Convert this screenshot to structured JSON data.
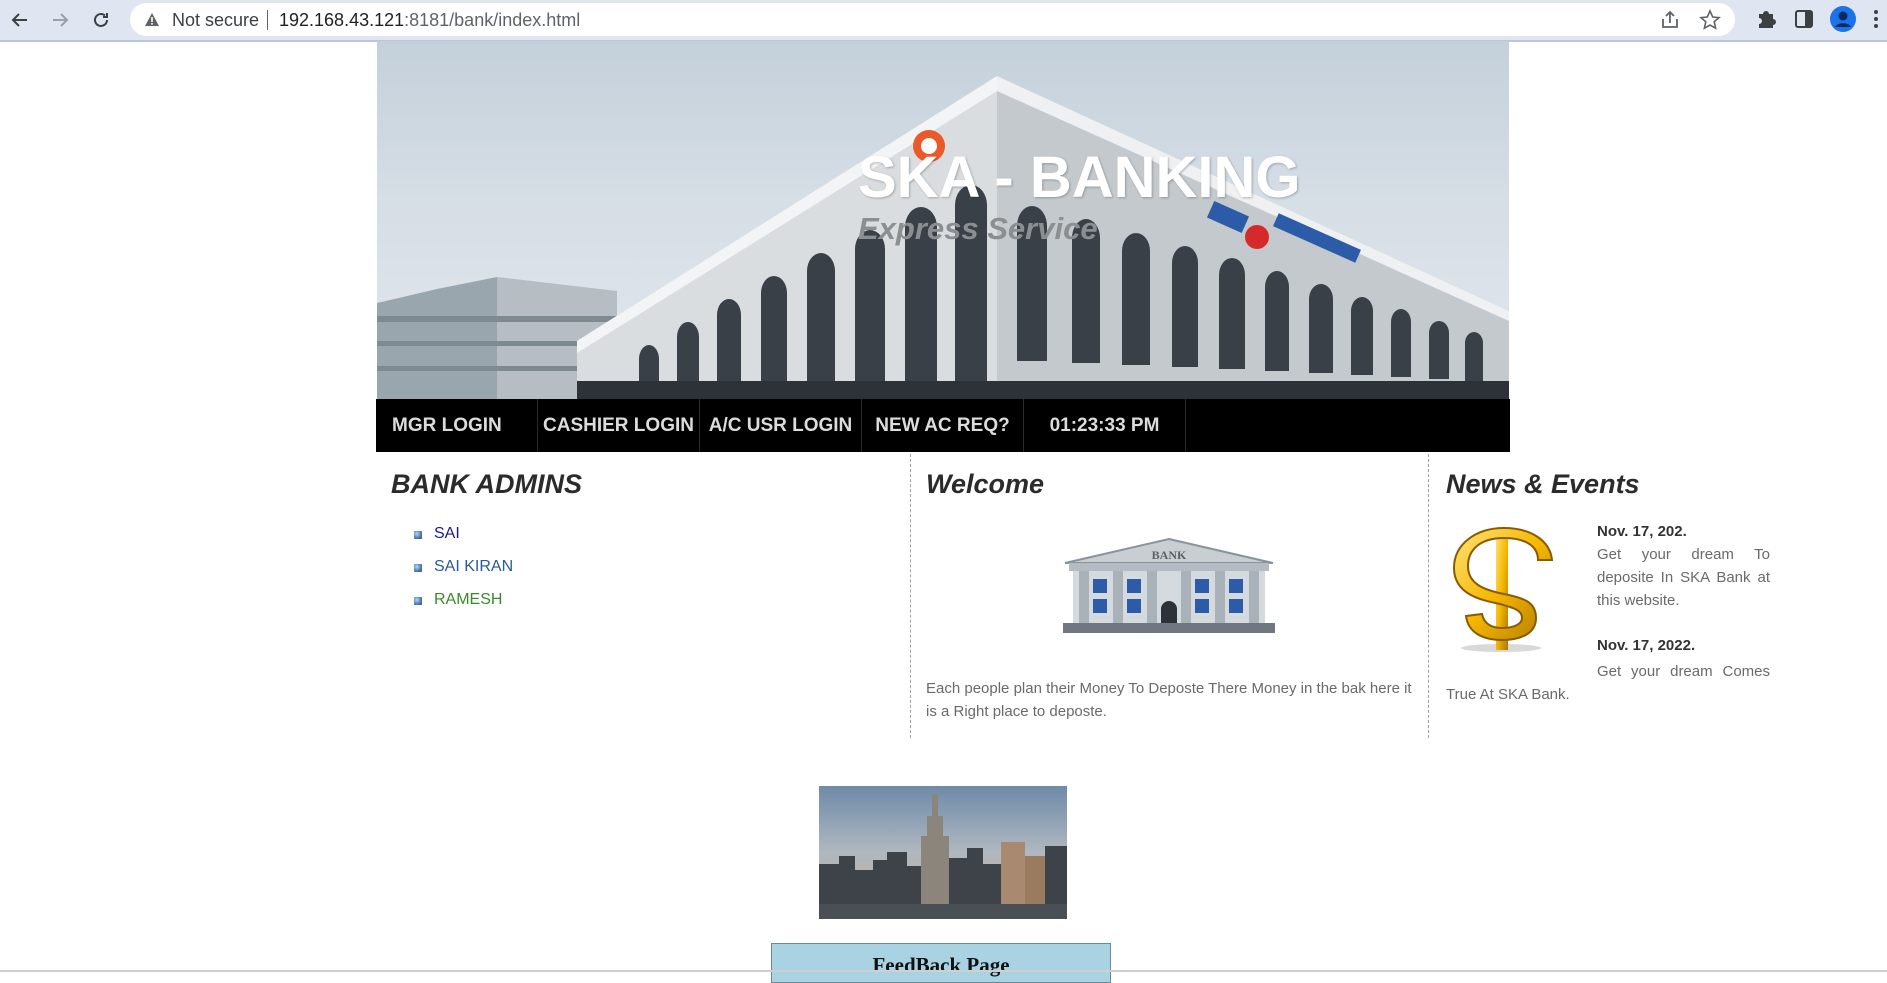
{
  "browser": {
    "security_label": "Not secure",
    "url_host": "192.168.43.121",
    "url_rest": ":8181/bank/index.html"
  },
  "site": {
    "title": "SKA - BANKING",
    "subtitle": "Express Service"
  },
  "menu": {
    "items": [
      {
        "label": "MGR LOGIN"
      },
      {
        "label": "CASHIER LOGIN"
      },
      {
        "label": "A/C USR LOGIN"
      },
      {
        "label": "NEW AC REQ?"
      }
    ],
    "clock": "01:23:33 PM"
  },
  "admins": {
    "heading": "BANK ADMINS",
    "items": [
      {
        "name": "SAI",
        "color": "#1a1a8c"
      },
      {
        "name": "SAI KIRAN",
        "color": "#2a5a9a"
      },
      {
        "name": "RAMESH",
        "color": "#3a8a2a"
      }
    ]
  },
  "welcome": {
    "heading": "Welcome",
    "image_label": "BANK",
    "text": "Each people plan their Money To Deposte There Money in the bak here it is a Right place to deposte."
  },
  "news": {
    "heading": "News & Events",
    "items": [
      {
        "date": "Nov. 17, 202.",
        "text": "Get your dream To deposite In SKA Bank at this website."
      },
      {
        "date": "Nov. 17, 2022.",
        "text": "Get your dream Comes True At SKA Bank."
      }
    ]
  },
  "feedback": {
    "label": "FeedBack Page"
  }
}
